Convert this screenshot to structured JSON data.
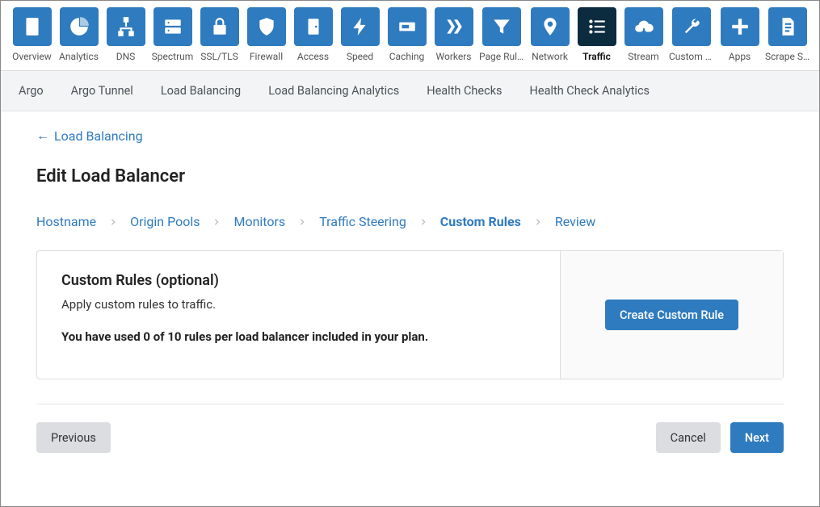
{
  "top_nav": [
    {
      "label": "Overview",
      "active": false,
      "icon": "clipboard"
    },
    {
      "label": "Analytics",
      "active": false,
      "icon": "pie"
    },
    {
      "label": "DNS",
      "active": false,
      "icon": "sitemap"
    },
    {
      "label": "Spectrum",
      "active": false,
      "icon": "server"
    },
    {
      "label": "SSL/TLS",
      "active": false,
      "icon": "lock"
    },
    {
      "label": "Firewall",
      "active": false,
      "icon": "shield"
    },
    {
      "label": "Access",
      "active": false,
      "icon": "door"
    },
    {
      "label": "Speed",
      "active": false,
      "icon": "bolt"
    },
    {
      "label": "Caching",
      "active": false,
      "icon": "drive"
    },
    {
      "label": "Workers",
      "active": false,
      "icon": "workers"
    },
    {
      "label": "Page Rules",
      "active": false,
      "icon": "funnel"
    },
    {
      "label": "Network",
      "active": false,
      "icon": "pin"
    },
    {
      "label": "Traffic",
      "active": true,
      "icon": "list"
    },
    {
      "label": "Stream",
      "active": false,
      "icon": "cloud"
    },
    {
      "label": "Custom P…",
      "active": false,
      "icon": "wrench"
    },
    {
      "label": "Apps",
      "active": false,
      "icon": "plus"
    },
    {
      "label": "Scrape S…",
      "active": false,
      "icon": "doc"
    }
  ],
  "sub_nav": [
    "Argo",
    "Argo Tunnel",
    "Load Balancing",
    "Load Balancing Analytics",
    "Health Checks",
    "Health Check Analytics"
  ],
  "back_link": "Load Balancing",
  "page_title": "Edit Load Balancer",
  "crumbs": [
    {
      "label": "Hostname",
      "active": false
    },
    {
      "label": "Origin Pools",
      "active": false
    },
    {
      "label": "Monitors",
      "active": false
    },
    {
      "label": "Traffic Steering",
      "active": false
    },
    {
      "label": "Custom Rules",
      "active": true
    },
    {
      "label": "Review",
      "active": false
    }
  ],
  "panel": {
    "heading": "Custom Rules (optional)",
    "desc": "Apply custom rules to traffic.",
    "usage": "You have used 0 of 10 rules per load balancer included in your plan.",
    "cta": "Create Custom Rule"
  },
  "footer": {
    "previous": "Previous",
    "cancel": "Cancel",
    "next": "Next"
  }
}
